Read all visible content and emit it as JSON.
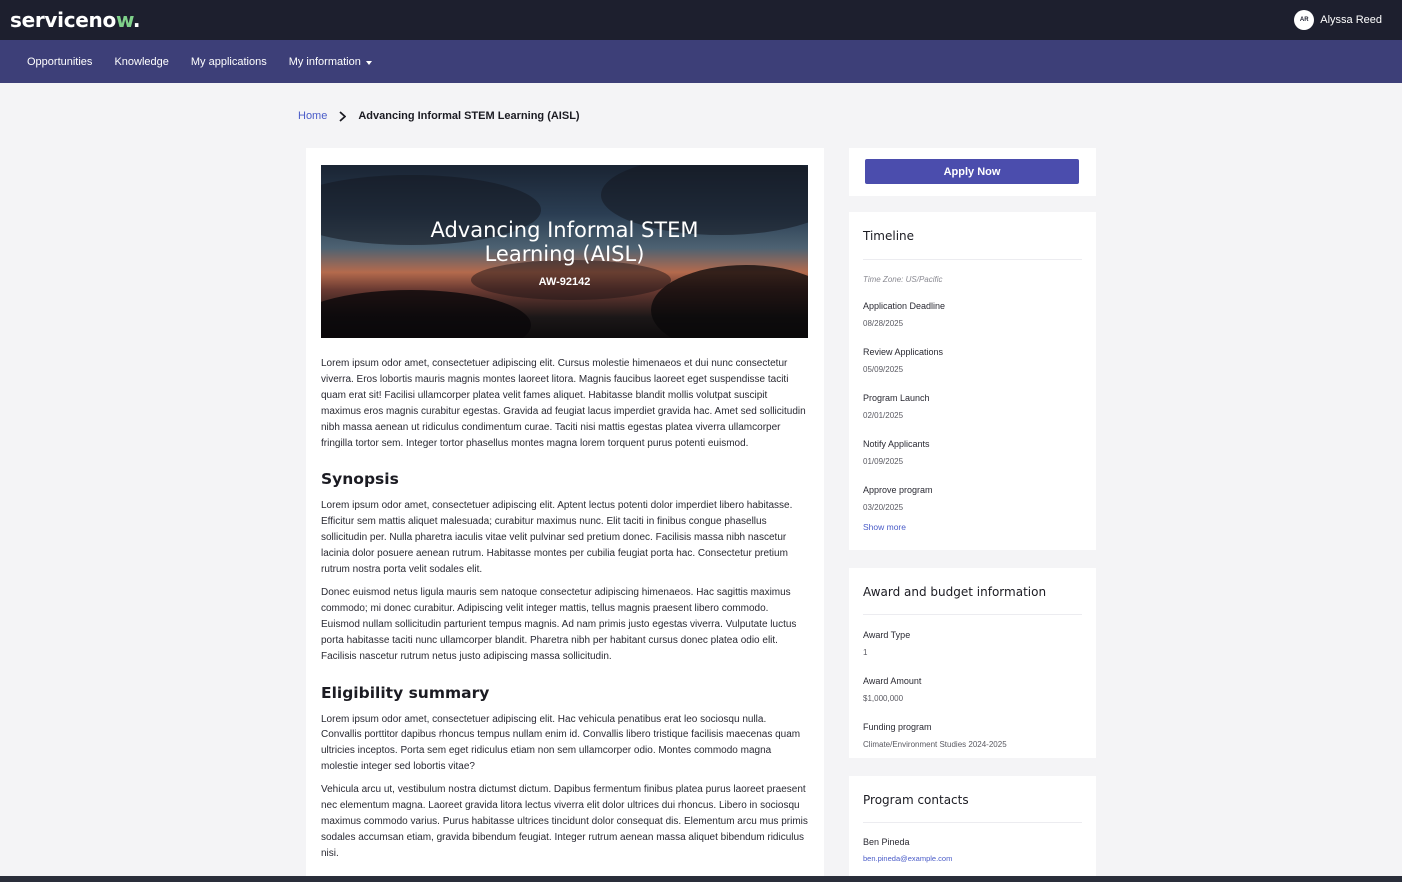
{
  "app": {
    "logo_text": "servicenow.",
    "user_initials": "AR",
    "user_name": "Alyssa Reed"
  },
  "nav": [
    {
      "label": "Opportunities"
    },
    {
      "label": "Knowledge"
    },
    {
      "label": "My applications"
    },
    {
      "label": "My information"
    }
  ],
  "breadcrumb": {
    "home": "Home",
    "current": "Advancing Informal STEM Learning (AISL)"
  },
  "hero": {
    "title_line1": "Advancing Informal STEM",
    "title_line2": "Learning (AISL)",
    "code": "AW-92142"
  },
  "content": {
    "intro": "Lorem ipsum odor amet, consectetuer adipiscing elit. Cursus molestie himenaeos et dui nunc consectetur viverra. Eros lobortis mauris magnis montes laoreet litora. Magnis faucibus laoreet eget suspendisse taciti quam erat sit! Facilisi ullamcorper platea velit fames aliquet. Habitasse blandit mollis volutpat suscipit maximus eros magnis curabitur egestas. Gravida ad feugiat lacus imperdiet gravida hac. Amet sed sollicitudin nibh massa aenean ut ridiculus condimentum curae. Taciti nisi mattis egestas platea viverra ullamcorper fringilla tortor sem. Integer tortor phasellus montes magna lorem torquent purus potenti euismod.",
    "synopsis_heading": "Synopsis",
    "synopsis_p1": "Lorem ipsum odor amet, consectetuer adipiscing elit. Aptent lectus potenti dolor imperdiet libero habitasse. Efficitur sem mattis aliquet malesuada; curabitur maximus nunc. Elit taciti in finibus congue phasellus sollicitudin per. Nulla pharetra iaculis vitae velit pulvinar sed pretium donec. Facilisis massa nibh nascetur lacinia dolor posuere aenean rutrum. Habitasse montes per cubilia feugiat porta hac. Consectetur pretium rutrum nostra porta velit sodales elit.",
    "synopsis_p2": "Donec euismod netus ligula mauris sem natoque consectetur adipiscing himenaeos. Hac sagittis maximus commodo; mi donec curabitur. Adipiscing velit integer mattis, tellus magnis praesent libero commodo. Euismod nullam sollicitudin parturient tempus magnis. Ad nam primis justo egestas viverra. Vulputate luctus porta habitasse taciti nunc ullamcorper blandit. Pharetra nibh per habitant cursus donec platea odio elit. Facilisis nascetur rutrum netus justo adipiscing massa sollicitudin.",
    "eligibility_heading": "Eligibility summary",
    "eligibility_p1": "Lorem ipsum odor amet, consectetuer adipiscing elit. Hac vehicula penatibus erat leo sociosqu nulla. Convallis porttitor dapibus rhoncus tempus nullam enim id. Convallis libero tristique facilisis maecenas quam ultricies inceptos. Porta sem eget ridiculus etiam non sem ullamcorper odio. Montes commodo magna molestie integer sed lobortis vitae?",
    "eligibility_p2": "Vehicula arcu ut, vestibulum nostra dictumst dictum. Dapibus fermentum finibus platea purus laoreet praesent nec elementum magna. Laoreet gravida litora lectus viverra elit dolor ultrices dui rhoncus. Libero in sociosqu maximus commodo varius. Purus habitasse ultrices tincidunt dolor consequat dis. Elementum arcu mus primis sodales accumsan etiam, gravida bibendum feugiat. Integer rutrum aenean massa aliquet bibendum ridiculus nisi."
  },
  "sidebar": {
    "apply_label": "Apply Now",
    "timeline": {
      "title": "Timeline",
      "timezone": "Time Zone: US/Pacific",
      "items": [
        {
          "label": "Application Deadline",
          "date": "08/28/2025"
        },
        {
          "label": "Review Applications",
          "date": "05/09/2025"
        },
        {
          "label": "Program Launch",
          "date": "02/01/2025"
        },
        {
          "label": "Notify Applicants",
          "date": "01/09/2025"
        },
        {
          "label": "Approve program",
          "date": "03/20/2025"
        }
      ],
      "show_more": "Show more"
    },
    "award": {
      "title": "Award and budget information",
      "items": [
        {
          "label": "Award Type",
          "value": "1"
        },
        {
          "label": "Award Amount",
          "value": "$1,000,000"
        },
        {
          "label": "Funding program",
          "value": "Climate/Environment Studies 2024-2025"
        }
      ]
    },
    "contacts": {
      "title": "Program contacts",
      "name": "Ben Pineda",
      "email": "ben.pineda@example.com"
    }
  }
}
